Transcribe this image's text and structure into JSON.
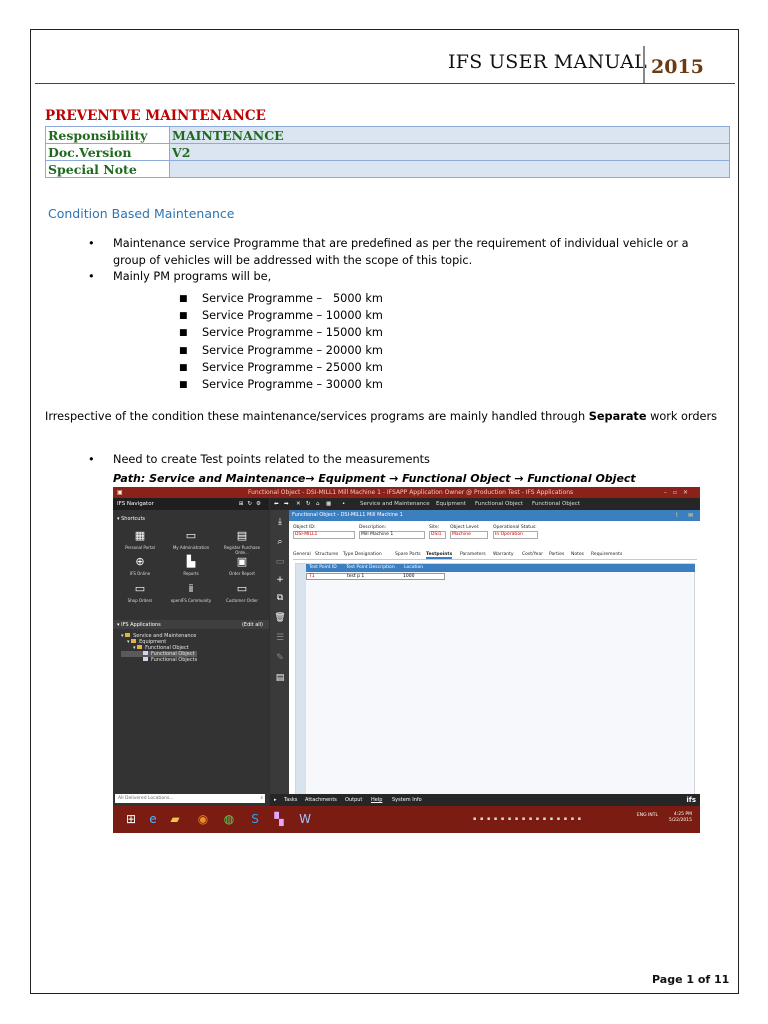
{
  "header": {
    "title": "IFS  USER MANUAL",
    "year": "2015"
  },
  "doc": {
    "heading": "PREVENTVE MAINTENANCE",
    "rows": [
      {
        "label": "Responsibility",
        "value": "MAINTENANCE"
      },
      {
        "label": "Doc.Version",
        "value": "V2"
      },
      {
        "label": "Special Note",
        "value": ""
      }
    ]
  },
  "section": {
    "title": "Condition Based Maintenance"
  },
  "bullets": [
    "Maintenance service Programme that are predefined as per the requirement of individual vehicle or a group of vehicles will be addressed with the scope of this topic.",
    "Mainly PM programs will be,"
  ],
  "programs": [
    "Service Programme –   5000 km",
    "Service Programme – 10000 km",
    "Service Programme – 15000 km",
    "Service Programme – 20000 km",
    "Service Programme – 25000 km",
    "Service Programme – 30000 km"
  ],
  "paragraph": {
    "before": "Irrespective of the condition these maintenance/services programs are mainly handled through ",
    "bold": "Separate",
    "after": " work orders"
  },
  "need": "Need to create Test points related to the measurements",
  "path": "Path: Service and Maintenance→ Equipment → Functional Object → Functional Object",
  "app": {
    "title": "Functional Object - DSI-MILL1 Mill Machine 1 - IFSAPP Application Owner @ Production Test - IFS Applications",
    "navigator": "IFS Navigator",
    "shortcuts_label": "Shortcuts",
    "shortcuts": [
      {
        "label": "Personal Portal",
        "icon": "calendar-icon"
      },
      {
        "label": "My Administration",
        "icon": "admin-icon"
      },
      {
        "label": "Register Purchase Orde...",
        "icon": "register-icon"
      },
      {
        "label": "IFS Online",
        "icon": "globe-icon"
      },
      {
        "label": "Reports",
        "icon": "reports-icon"
      },
      {
        "label": "Order Report",
        "icon": "order-report-icon"
      },
      {
        "label": "Shop Orders",
        "icon": "shop-orders-icon"
      },
      {
        "label": "openIFS Community",
        "icon": "community-icon"
      },
      {
        "label": "Customer Order",
        "icon": "customer-order-icon"
      }
    ],
    "applications_label": "IFS Applications",
    "edit_all": "(Edit all)",
    "tree": [
      "Service and Maintenance",
      "Equipment",
      "Functional Object",
      "Functional Object",
      "Functional Objects"
    ],
    "location_placeholder": "All Delivered Locations...",
    "breadcrumbs": [
      "Service and Maintenance",
      "Equipment",
      "Functional Object",
      "Functional Object"
    ],
    "form_title": "Functional Object - DSI-MILL1 Mill Machine 1",
    "fields": [
      {
        "label": "Object ID:",
        "value": "DSI-MILL1"
      },
      {
        "label": "Description:",
        "value": "Mill Machine 1"
      },
      {
        "label": "Site:",
        "value": "DSI1"
      },
      {
        "label": "Object Level:",
        "value": "Machine"
      },
      {
        "label": "Operational Status:",
        "value": "In Operation"
      }
    ],
    "tabs": [
      "General",
      "Structures",
      "Type Designation",
      "Spare Parts",
      "Testpoints",
      "Parameters",
      "Warranty",
      "Cost/Year",
      "Parties",
      "Notes",
      "Requirements"
    ],
    "active_tab": "Testpoints",
    "grid_columns": [
      "Test Point ID",
      "Test Point Description",
      "Location"
    ],
    "grid_rows": [
      {
        "id": "T1",
        "description": "test p 1",
        "location": "1000"
      }
    ],
    "bottom_links": [
      "Tasks",
      "Attachments",
      "Output",
      "Help",
      "System Info"
    ],
    "taskbar": {
      "lang": "ENG\nINTL",
      "time": "4:25 PM",
      "date": "5/22/2015"
    }
  },
  "footer": "Page 1 of 11",
  "colors": {
    "heading_red": "#c00000",
    "label_green": "#1f6a1f",
    "section_blue": "#2e74b5",
    "year_brown": "#6b3a13",
    "app_accent": "#3c7fc1",
    "title_red": "#8a2219"
  }
}
